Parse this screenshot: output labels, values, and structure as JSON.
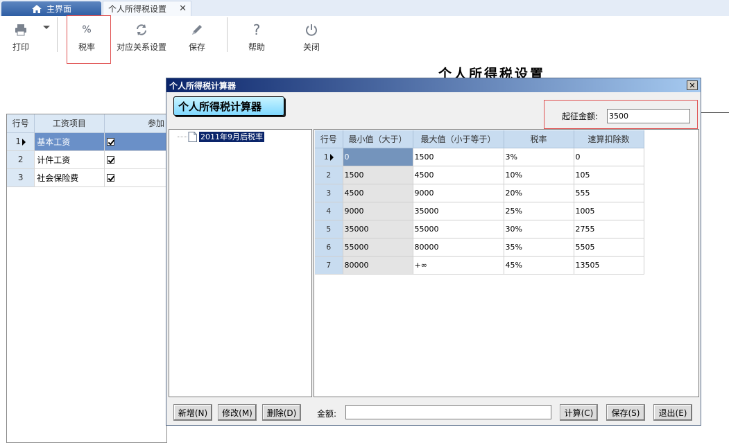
{
  "tabs": {
    "home_label": "主界面",
    "active_label": "个人所得税设置",
    "close_glyph": "✕"
  },
  "toolbar": {
    "print": "打印",
    "tax_rate": "税率",
    "tax_rate_glyph": "%",
    "mapping": "对应关系设置",
    "save": "保存",
    "help": "帮助",
    "help_glyph": "?",
    "close": "关闭"
  },
  "page": {
    "title": "个人所得税设置"
  },
  "bg_grid": {
    "headers": [
      "行号",
      "工资项目",
      "参加"
    ],
    "rows": [
      {
        "no": "1",
        "item": "基本工资",
        "checked": true
      },
      {
        "no": "2",
        "item": "计件工资",
        "checked": true
      },
      {
        "no": "3",
        "item": "社会保险费",
        "checked": true
      }
    ]
  },
  "dialog": {
    "title": "个人所得税计算器",
    "close_glyph": "✕",
    "banner": "个人所得税计算器",
    "start_label": "起征金额:",
    "start_value": "3500",
    "tree_node": "2011年9月后税率",
    "grid_headers": [
      "行号",
      "最小值（大于）",
      "最大值（小于等于）",
      "税率",
      "速算扣除数"
    ],
    "grid_rows": [
      [
        "1",
        "0",
        "1500",
        "3%",
        "0"
      ],
      [
        "2",
        "1500",
        "4500",
        "10%",
        "105"
      ],
      [
        "3",
        "4500",
        "9000",
        "20%",
        "555"
      ],
      [
        "4",
        "9000",
        "35000",
        "25%",
        "1005"
      ],
      [
        "5",
        "35000",
        "55000",
        "30%",
        "2755"
      ],
      [
        "6",
        "55000",
        "80000",
        "35%",
        "5505"
      ],
      [
        "7",
        "80000",
        "+∞",
        "45%",
        "13505"
      ]
    ],
    "buttons": {
      "add": "新增(N)",
      "edit": "修改(M)",
      "delete": "删除(D)",
      "amount_label": "金额:",
      "calc": "计算(C)",
      "save": "保存(S)",
      "exit": "退出(E)"
    }
  },
  "colors": {
    "accent": "#2e5ea4",
    "highlight_border": "#e05050",
    "selected_row": "#6a90c8"
  }
}
